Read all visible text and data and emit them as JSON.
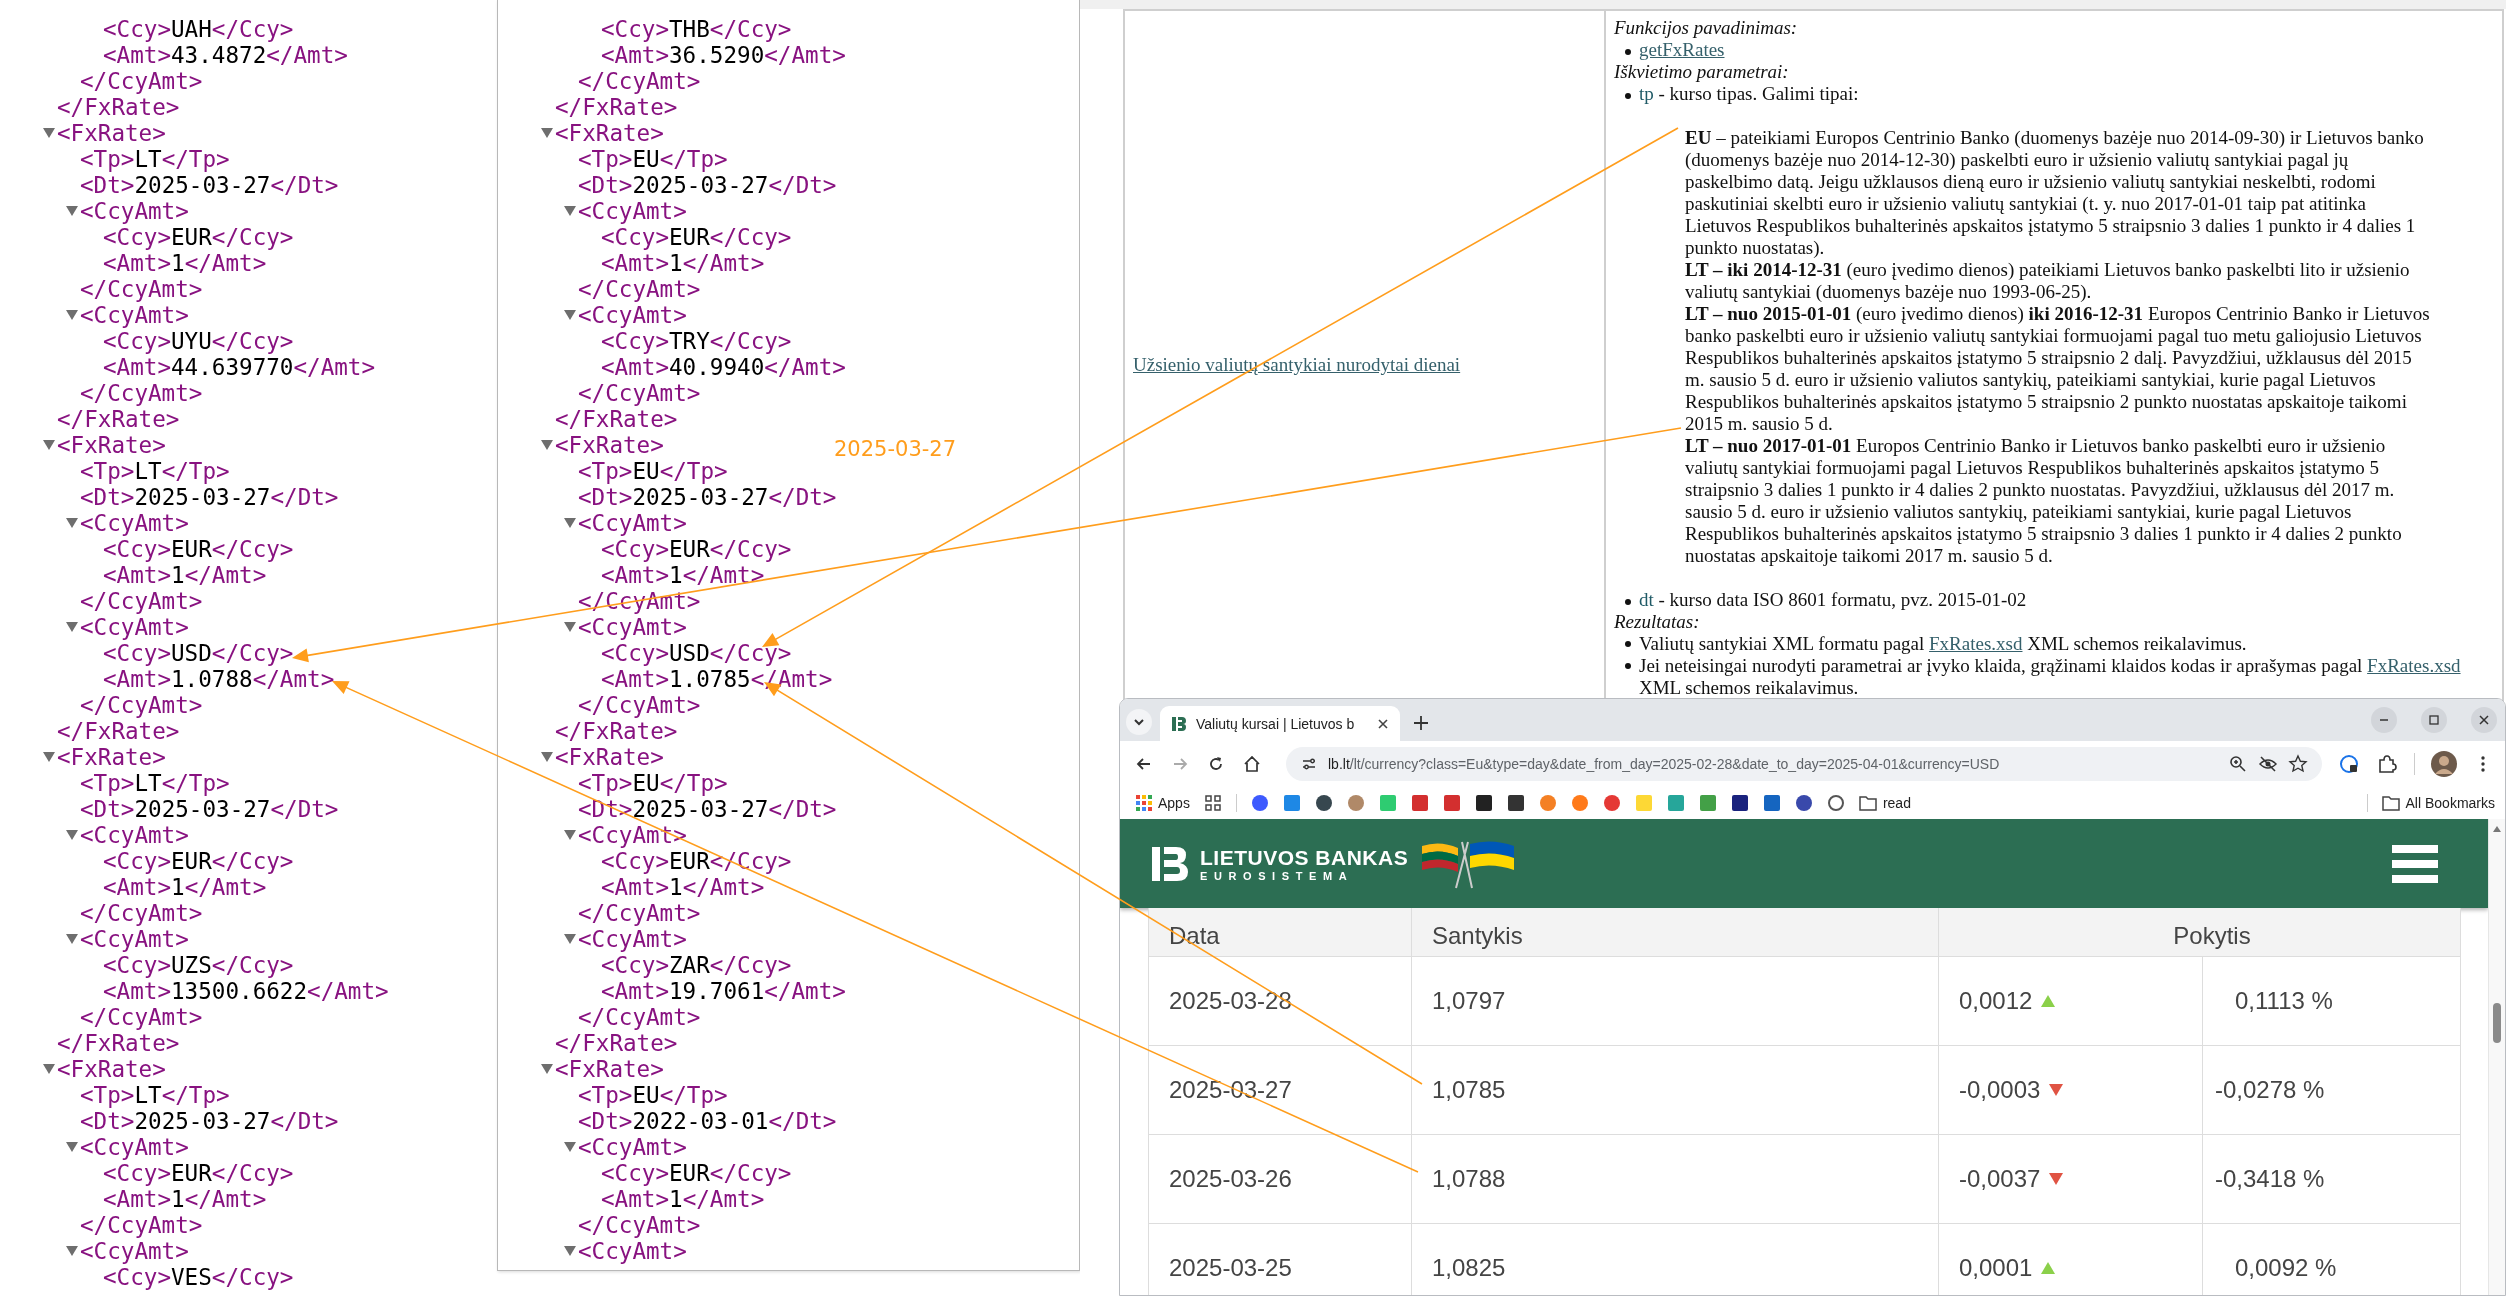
{
  "xml_left": {
    "nodes": [
      {
        "kind": "element",
        "children": [
          {
            "kind": "element",
            "children": [
              {
                "kind": "leaf",
                "open": "<Ccy>",
                "value": "UAH",
                "close": "</Ccy>"
              },
              {
                "kind": "leaf",
                "open": "<Amt>",
                "value": "43.4872",
                "close": "</Amt>"
              }
            ],
            "close": "</CcyAmt>"
          }
        ],
        "close": "</FxRate>"
      },
      {
        "kind": "element",
        "open": "<FxRate>",
        "expanded": true,
        "children": [
          {
            "kind": "leaf",
            "open": "<Tp>",
            "value": "LT",
            "close": "</Tp>"
          },
          {
            "kind": "leaf",
            "open": "<Dt>",
            "value": "2025-03-27",
            "close": "</Dt>"
          },
          {
            "kind": "element",
            "open": "<CcyAmt>",
            "expanded": true,
            "children": [
              {
                "kind": "leaf",
                "open": "<Ccy>",
                "value": "EUR",
                "close": "</Ccy>"
              },
              {
                "kind": "leaf",
                "open": "<Amt>",
                "value": "1",
                "close": "</Amt>"
              }
            ],
            "close": "</CcyAmt>"
          },
          {
            "kind": "element",
            "open": "<CcyAmt>",
            "expanded": true,
            "children": [
              {
                "kind": "leaf",
                "open": "<Ccy>",
                "value": "UYU",
                "close": "</Ccy>"
              },
              {
                "kind": "leaf",
                "open": "<Amt>",
                "value": "44.639770",
                "close": "</Amt>"
              }
            ],
            "close": "</CcyAmt>"
          }
        ],
        "close": "</FxRate>"
      },
      {
        "kind": "element",
        "open": "<FxRate>",
        "expanded": true,
        "children": [
          {
            "kind": "leaf",
            "open": "<Tp>",
            "value": "LT",
            "close": "</Tp>"
          },
          {
            "kind": "leaf",
            "open": "<Dt>",
            "value": "2025-03-27",
            "close": "</Dt>"
          },
          {
            "kind": "element",
            "open": "<CcyAmt>",
            "expanded": true,
            "children": [
              {
                "kind": "leaf",
                "open": "<Ccy>",
                "value": "EUR",
                "close": "</Ccy>"
              },
              {
                "kind": "leaf",
                "open": "<Amt>",
                "value": "1",
                "close": "</Amt>"
              }
            ],
            "close": "</CcyAmt>"
          },
          {
            "kind": "element",
            "open": "<CcyAmt>",
            "expanded": true,
            "children": [
              {
                "kind": "leaf",
                "open": "<Ccy>",
                "value": "USD",
                "close": "</Ccy>"
              },
              {
                "kind": "leaf",
                "open": "<Amt>",
                "value": "1.0788",
                "close": "</Amt>"
              }
            ],
            "close": "</CcyAmt>"
          }
        ],
        "close": "</FxRate>"
      },
      {
        "kind": "element",
        "open": "<FxRate>",
        "expanded": true,
        "children": [
          {
            "kind": "leaf",
            "open": "<Tp>",
            "value": "LT",
            "close": "</Tp>"
          },
          {
            "kind": "leaf",
            "open": "<Dt>",
            "value": "2025-03-27",
            "close": "</Dt>"
          },
          {
            "kind": "element",
            "open": "<CcyAmt>",
            "expanded": true,
            "children": [
              {
                "kind": "leaf",
                "open": "<Ccy>",
                "value": "EUR",
                "close": "</Ccy>"
              },
              {
                "kind": "leaf",
                "open": "<Amt>",
                "value": "1",
                "close": "</Amt>"
              }
            ],
            "close": "</CcyAmt>"
          },
          {
            "kind": "element",
            "open": "<CcyAmt>",
            "expanded": true,
            "children": [
              {
                "kind": "leaf",
                "open": "<Ccy>",
                "value": "UZS",
                "close": "</Ccy>"
              },
              {
                "kind": "leaf",
                "open": "<Amt>",
                "value": "13500.6622",
                "close": "</Amt>"
              }
            ],
            "close": "</CcyAmt>"
          }
        ],
        "close": "</FxRate>"
      },
      {
        "kind": "element",
        "open": "<FxRate>",
        "expanded": true,
        "children": [
          {
            "kind": "leaf",
            "open": "<Tp>",
            "value": "LT",
            "close": "</Tp>"
          },
          {
            "kind": "leaf",
            "open": "<Dt>",
            "value": "2025-03-27",
            "close": "</Dt>"
          },
          {
            "kind": "element",
            "open": "<CcyAmt>",
            "expanded": true,
            "children": [
              {
                "kind": "leaf",
                "open": "<Ccy>",
                "value": "EUR",
                "close": "</Ccy>"
              },
              {
                "kind": "leaf",
                "open": "<Amt>",
                "value": "1",
                "close": "</Amt>"
              }
            ],
            "close": "</CcyAmt>"
          },
          {
            "kind": "element",
            "open": "<CcyAmt>",
            "expanded": true,
            "children": [
              {
                "kind": "leaf",
                "open": "<Ccy>",
                "value": "VES",
                "close": "</Ccy>"
              }
            ]
          }
        ]
      }
    ]
  },
  "xml_right": {
    "nodes": [
      {
        "kind": "element",
        "children": [
          {
            "kind": "element",
            "children": [
              {
                "kind": "leaf",
                "open": "<Ccy>",
                "value": "THB",
                "close": "</Ccy>"
              },
              {
                "kind": "leaf",
                "open": "<Amt>",
                "value": "36.5290",
                "close": "</Amt>"
              }
            ],
            "close": "</CcyAmt>"
          }
        ],
        "close": "</FxRate>"
      },
      {
        "kind": "element",
        "open": "<FxRate>",
        "expanded": true,
        "children": [
          {
            "kind": "leaf",
            "open": "<Tp>",
            "value": "EU",
            "close": "</Tp>"
          },
          {
            "kind": "leaf",
            "open": "<Dt>",
            "value": "2025-03-27",
            "close": "</Dt>"
          },
          {
            "kind": "element",
            "open": "<CcyAmt>",
            "expanded": true,
            "children": [
              {
                "kind": "leaf",
                "open": "<Ccy>",
                "value": "EUR",
                "close": "</Ccy>"
              },
              {
                "kind": "leaf",
                "open": "<Amt>",
                "value": "1",
                "close": "</Amt>"
              }
            ],
            "close": "</CcyAmt>"
          },
          {
            "kind": "element",
            "open": "<CcyAmt>",
            "expanded": true,
            "children": [
              {
                "kind": "leaf",
                "open": "<Ccy>",
                "value": "TRY",
                "close": "</Ccy>"
              },
              {
                "kind": "leaf",
                "open": "<Amt>",
                "value": "40.9940",
                "close": "</Amt>"
              }
            ],
            "close": "</CcyAmt>"
          }
        ],
        "close": "</FxRate>"
      },
      {
        "kind": "element",
        "open": "<FxRate>",
        "expanded": true,
        "children": [
          {
            "kind": "leaf",
            "open": "<Tp>",
            "value": "EU",
            "close": "</Tp>"
          },
          {
            "kind": "leaf",
            "open": "<Dt>",
            "value": "2025-03-27",
            "close": "</Dt>"
          },
          {
            "kind": "element",
            "open": "<CcyAmt>",
            "expanded": true,
            "children": [
              {
                "kind": "leaf",
                "open": "<Ccy>",
                "value": "EUR",
                "close": "</Ccy>"
              },
              {
                "kind": "leaf",
                "open": "<Amt>",
                "value": "1",
                "close": "</Amt>"
              }
            ],
            "close": "</CcyAmt>"
          },
          {
            "kind": "element",
            "open": "<CcyAmt>",
            "expanded": true,
            "children": [
              {
                "kind": "leaf",
                "open": "<Ccy>",
                "value": "USD",
                "close": "</Ccy>"
              },
              {
                "kind": "leaf",
                "open": "<Amt>",
                "value": "1.0785",
                "close": "</Amt>"
              }
            ],
            "close": "</CcyAmt>"
          }
        ],
        "close": "</FxRate>"
      },
      {
        "kind": "element",
        "open": "<FxRate>",
        "expanded": true,
        "children": [
          {
            "kind": "leaf",
            "open": "<Tp>",
            "value": "EU",
            "close": "</Tp>"
          },
          {
            "kind": "leaf",
            "open": "<Dt>",
            "value": "2025-03-27",
            "close": "</Dt>"
          },
          {
            "kind": "element",
            "open": "<CcyAmt>",
            "expanded": true,
            "children": [
              {
                "kind": "leaf",
                "open": "<Ccy>",
                "value": "EUR",
                "close": "</Ccy>"
              },
              {
                "kind": "leaf",
                "open": "<Amt>",
                "value": "1",
                "close": "</Amt>"
              }
            ],
            "close": "</CcyAmt>"
          },
          {
            "kind": "element",
            "open": "<CcyAmt>",
            "expanded": true,
            "children": [
              {
                "kind": "leaf",
                "open": "<Ccy>",
                "value": "ZAR",
                "close": "</Ccy>"
              },
              {
                "kind": "leaf",
                "open": "<Amt>",
                "value": "19.7061",
                "close": "</Amt>"
              }
            ],
            "close": "</CcyAmt>"
          }
        ],
        "close": "</FxRate>"
      },
      {
        "kind": "element",
        "open": "<FxRate>",
        "expanded": true,
        "children": [
          {
            "kind": "leaf",
            "open": "<Tp>",
            "value": "EU",
            "close": "</Tp>"
          },
          {
            "kind": "leaf",
            "open": "<Dt>",
            "value": "2022-03-01",
            "close": "</Dt>"
          },
          {
            "kind": "element",
            "open": "<CcyAmt>",
            "expanded": true,
            "children": [
              {
                "kind": "leaf",
                "open": "<Ccy>",
                "value": "EUR",
                "close": "</Ccy>"
              },
              {
                "kind": "leaf",
                "open": "<Amt>",
                "value": "1",
                "close": "</Amt>"
              }
            ],
            "close": "</CcyAmt>"
          },
          {
            "kind": "element",
            "open": "<CcyAmt>",
            "expanded": true
          }
        ]
      }
    ]
  },
  "annotation": {
    "label": "2025-03-27"
  },
  "documentation": {
    "link": "Užsienio valiutų santykiai nurodytai dienai",
    "blocks": [
      {
        "kind": "heading",
        "text": "Funkcijos pavadinimas:"
      },
      {
        "kind": "link_item",
        "text": "getFxRates"
      },
      {
        "kind": "heading",
        "text": "Iškvietimo parametrai:"
      },
      {
        "kind": "param_item",
        "param": "tp",
        "text": " - kurso tipas. Galimi tipai:"
      },
      {
        "kind": "types",
        "paragraphs": [
          "**EU** – pateikiami Europos Centrinio Banko (duomenys bazėje nuo 2014-09-30) ir Lietuvos banko (duomenys bazėje nuo 2014-12-30) paskelbti euro ir užsienio valiutų santykiai pagal jų paskelbimo datą. Jeigu užklausos dieną euro ir užsienio valiutų santykiai neskelbti, rodomi paskutiniai skelbti euro ir užsienio valiutų santykiai (t. y. nuo 2017-01-01 taip pat atitinka Lietuvos Respublikos buhalterinės apskaitos įstatymo 5 straipsnio 3 dalies 1 punkto ir 4 dalies 1 punkto nuostatas).",
          "**LT – iki 2014-12-31** (euro įvedimo dienos) pateikiami Lietuvos banko paskelbti lito ir užsienio valiutų santykiai (duomenys bazėje nuo 1993-06-25).",
          "**LT – nuo 2015-01-01** (euro įvedimo dienos) **iki 2016-12-31** Europos Centrinio Banko ir Lietuvos banko paskelbti euro ir užsienio valiutų santykiai formuojami pagal tuo metu galiojusio Lietuvos Respublikos buhalterinės apskaitos įstatymo 5 straipsnio 2 dalį. Pavyzdžiui, užklausus dėl 2015 m. sausio 5 d. euro ir užsienio valiutos santykių, pateikiami santykiai, kurie pagal Lietuvos Respublikos buhalterinės apskaitos įstatymo 5 straipsnio 2 punkto nuostatas apskaitoje taikomi 2015 m. sausio 5 d.",
          "**LT – nuo 2017-01-01** Europos Centrinio Banko ir Lietuvos banko paskelbti euro ir užsienio valiutų santykiai formuojami pagal Lietuvos Respublikos buhalterinės apskaitos įstatymo 5 straipsnio 3 dalies 1 punkto ir 4 dalies 2 punkto nuostatas. Pavyzdžiui, užklausus dėl 2017 m. sausio 5 d. euro ir užsienio valiutos santykių, pateikiami santykiai, kurie pagal Lietuvos Respublikos buhalterinės apskaitos įstatymo 5 straipsnio 3 dalies 1 punkto ir 4 dalies 2 punkto nuostatas apskaitoje taikomi 2017 m. sausio 5 d."
        ]
      },
      {
        "kind": "param_item",
        "param": "dt",
        "text": " - kurso data ISO 8601 formatu, pvz. 2015-01-02"
      },
      {
        "kind": "heading",
        "text": "Rezultatas:"
      },
      {
        "kind": "result_item",
        "before": "Valiutų santykiai XML formatu pagal ",
        "link": "FxRates.xsd",
        "after": " XML schemos reikalavimus."
      },
      {
        "kind": "result_item",
        "before": "Jei neteisingai nurodyti parametrai ar įvyko klaida, grąžinami klaidos kodas ir aprašymas pagal ",
        "link": "FxRates.xsd",
        "after": " XML schemos reikalavimus."
      }
    ]
  },
  "browser": {
    "tab": {
      "title": "Valiutų kursai | Lietuvos b"
    },
    "address": {
      "host": "lb.lt",
      "path": "/lt/currency?class=Eu&type=day&date_from_day=2025-02-28&date_to_day=2025-04-01&currency=USD"
    },
    "bookmarks": {
      "apps": "Apps",
      "folder": "read",
      "all": "All Bookmarks"
    },
    "site": {
      "brand": "LIETUVOS BANKAS",
      "sub": "EUROSISTEMA"
    },
    "table": {
      "columns": [
        "Data",
        "Santykis",
        "Pokytis"
      ],
      "rows": [
        {
          "date": "2025-03-28",
          "rate": "1,0797",
          "change": "0,0012",
          "kind": "up",
          "percent": "0,1113 %"
        },
        {
          "date": "2025-03-27",
          "rate": "1,0785",
          "change": "-0,0003",
          "kind": "down",
          "percent": "-0,0278 %"
        },
        {
          "date": "2025-03-26",
          "rate": "1,0788",
          "change": "-0,0037",
          "kind": "down",
          "percent": "-0,3418 %"
        },
        {
          "date": "2025-03-25",
          "rate": "1,0825",
          "change": "0,0001",
          "kind": "up",
          "percent": "0,0092 %"
        }
      ]
    }
  }
}
